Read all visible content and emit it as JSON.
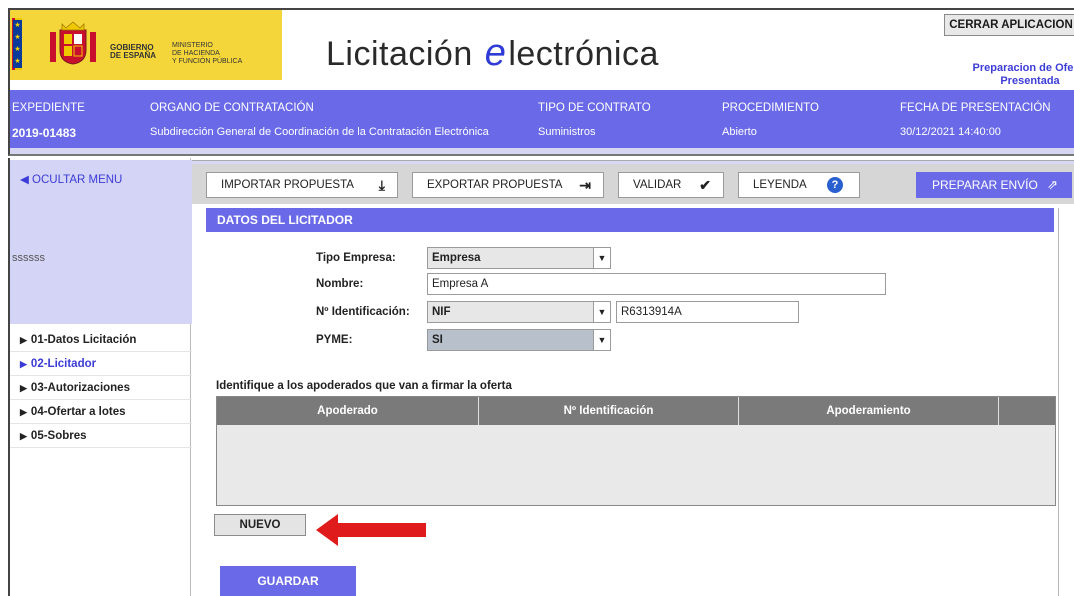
{
  "header": {
    "gov_label": "GOBIERNO\nDE ESPAÑA",
    "gov_line1": "GOBIERNO",
    "gov_line2": "DE ESPAÑA",
    "ministry_line1": "MINISTERIO",
    "ministry_line2": "DE HACIENDA",
    "ministry_line3": "Y FUNCIÓN PÚBLICA",
    "title_before": "Licitación ",
    "title_e": "e",
    "title_after": "lectrónica",
    "close_button": "CERRAR APLICACION",
    "status_line1": "Preparacion de Oferta",
    "status_line2": "Presentada"
  },
  "infobar": {
    "expediente_label": "EXPEDIENTE",
    "expediente_value": "2019-01483",
    "organo_label": "ORGANO DE CONTRATACIÓN",
    "organo_value": "Subdirección General de Coordinación de la Contratación Electrónica",
    "tipo_label": "TIPO DE CONTRATO",
    "tipo_value": "Suministros",
    "procedimiento_label": "PROCEDIMIENTO",
    "procedimiento_value": "Abierto",
    "fecha_label": "FECHA DE PRESENTACIÓN",
    "fecha_value": "30/12/2021 14:40:00"
  },
  "sidebar": {
    "hide_menu": "OCULTAR MENU",
    "user": "ssssss",
    "items": [
      {
        "label": "01-Datos Licitación",
        "active": false
      },
      {
        "label": "02-Licitador",
        "active": true
      },
      {
        "label": "03-Autorizaciones",
        "active": false
      },
      {
        "label": "04-Ofertar a lotes",
        "active": false
      },
      {
        "label": "05-Sobres",
        "active": false
      }
    ]
  },
  "toolbar": {
    "import": "IMPORTAR PROPUESTA",
    "export": "EXPORTAR PROPUESTA",
    "validate": "VALIDAR",
    "legend": "LEYENDA",
    "send": "PREPARAR ENVÍO"
  },
  "form": {
    "section_title": "DATOS DEL LICITADOR",
    "tipo_empresa_label": "Tipo Empresa:",
    "tipo_empresa_value": "Empresa",
    "nombre_label": "Nombre:",
    "nombre_value": "Empresa A",
    "identificacion_label": "Nº Identificación:",
    "identificacion_type": "NIF",
    "identificacion_value": "R6313914A",
    "pyme_label": "PYME:",
    "pyme_value": "SI"
  },
  "apoderados": {
    "caption": "Identifique a los apoderados que van a firmar la oferta",
    "columns": [
      "Apoderado",
      "Nº Identificación",
      "Apoderamiento",
      ""
    ],
    "rows": []
  },
  "buttons": {
    "new": "NUEVO",
    "save": "GUARDAR"
  },
  "colors": {
    "accent": "#6a6ae8",
    "link": "#3b3bd6",
    "logo_yellow": "#f4d63a",
    "arrow_red": "#e01b1b"
  }
}
